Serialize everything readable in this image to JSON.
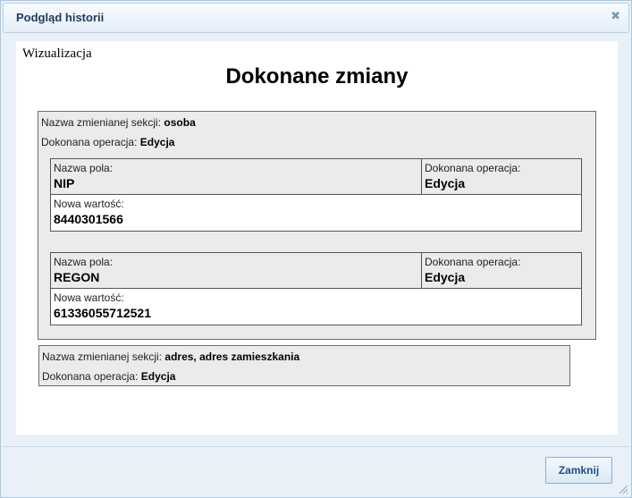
{
  "dialog": {
    "title": "Podgląd historii",
    "close_icon": "✖",
    "close_button_label": "Zamknij"
  },
  "content": {
    "viz_label": "Wizualizacja",
    "heading": "Dokonane zmiany",
    "sections": [
      {
        "section_label": "Nazwa zmienianej sekcji:",
        "section_name": "osoba",
        "operation_label": "Dokonana operacja:",
        "operation_value": "Edycja",
        "fields": [
          {
            "field_name_label": "Nazwa pola:",
            "field_name": "NIP",
            "op_label": "Dokonana operacja:",
            "op_value": "Edycja",
            "new_value_label": "Nowa wartość:",
            "new_value": "8440301566"
          },
          {
            "field_name_label": "Nazwa pola:",
            "field_name": "REGON",
            "op_label": "Dokonana operacja:",
            "op_value": "Edycja",
            "new_value_label": "Nowa wartość:",
            "new_value": "61336055712521"
          }
        ]
      },
      {
        "section_label": "Nazwa zmienianej sekcji:",
        "section_name": "adres, adres zamieszkania",
        "operation_label": "Dokonana operacja:",
        "operation_value": "Edycja"
      }
    ]
  }
}
